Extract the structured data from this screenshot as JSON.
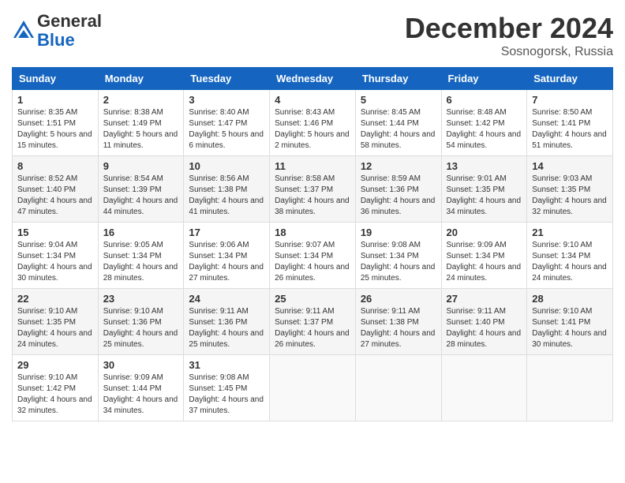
{
  "header": {
    "logo_general": "General",
    "logo_blue": "Blue",
    "month_title": "December 2024",
    "location": "Sosnogorsk, Russia"
  },
  "weekdays": [
    "Sunday",
    "Monday",
    "Tuesday",
    "Wednesday",
    "Thursday",
    "Friday",
    "Saturday"
  ],
  "weeks": [
    [
      {
        "day": "1",
        "sunrise": "8:35 AM",
        "sunset": "1:51 PM",
        "daylight": "5 hours and 15 minutes."
      },
      {
        "day": "2",
        "sunrise": "8:38 AM",
        "sunset": "1:49 PM",
        "daylight": "5 hours and 11 minutes."
      },
      {
        "day": "3",
        "sunrise": "8:40 AM",
        "sunset": "1:47 PM",
        "daylight": "5 hours and 6 minutes."
      },
      {
        "day": "4",
        "sunrise": "8:43 AM",
        "sunset": "1:46 PM",
        "daylight": "5 hours and 2 minutes."
      },
      {
        "day": "5",
        "sunrise": "8:45 AM",
        "sunset": "1:44 PM",
        "daylight": "4 hours and 58 minutes."
      },
      {
        "day": "6",
        "sunrise": "8:48 AM",
        "sunset": "1:42 PM",
        "daylight": "4 hours and 54 minutes."
      },
      {
        "day": "7",
        "sunrise": "8:50 AM",
        "sunset": "1:41 PM",
        "daylight": "4 hours and 51 minutes."
      }
    ],
    [
      {
        "day": "8",
        "sunrise": "8:52 AM",
        "sunset": "1:40 PM",
        "daylight": "4 hours and 47 minutes."
      },
      {
        "day": "9",
        "sunrise": "8:54 AM",
        "sunset": "1:39 PM",
        "daylight": "4 hours and 44 minutes."
      },
      {
        "day": "10",
        "sunrise": "8:56 AM",
        "sunset": "1:38 PM",
        "daylight": "4 hours and 41 minutes."
      },
      {
        "day": "11",
        "sunrise": "8:58 AM",
        "sunset": "1:37 PM",
        "daylight": "4 hours and 38 minutes."
      },
      {
        "day": "12",
        "sunrise": "8:59 AM",
        "sunset": "1:36 PM",
        "daylight": "4 hours and 36 minutes."
      },
      {
        "day": "13",
        "sunrise": "9:01 AM",
        "sunset": "1:35 PM",
        "daylight": "4 hours and 34 minutes."
      },
      {
        "day": "14",
        "sunrise": "9:03 AM",
        "sunset": "1:35 PM",
        "daylight": "4 hours and 32 minutes."
      }
    ],
    [
      {
        "day": "15",
        "sunrise": "9:04 AM",
        "sunset": "1:34 PM",
        "daylight": "4 hours and 30 minutes."
      },
      {
        "day": "16",
        "sunrise": "9:05 AM",
        "sunset": "1:34 PM",
        "daylight": "4 hours and 28 minutes."
      },
      {
        "day": "17",
        "sunrise": "9:06 AM",
        "sunset": "1:34 PM",
        "daylight": "4 hours and 27 minutes."
      },
      {
        "day": "18",
        "sunrise": "9:07 AM",
        "sunset": "1:34 PM",
        "daylight": "4 hours and 26 minutes."
      },
      {
        "day": "19",
        "sunrise": "9:08 AM",
        "sunset": "1:34 PM",
        "daylight": "4 hours and 25 minutes."
      },
      {
        "day": "20",
        "sunrise": "9:09 AM",
        "sunset": "1:34 PM",
        "daylight": "4 hours and 24 minutes."
      },
      {
        "day": "21",
        "sunrise": "9:10 AM",
        "sunset": "1:34 PM",
        "daylight": "4 hours and 24 minutes."
      }
    ],
    [
      {
        "day": "22",
        "sunrise": "9:10 AM",
        "sunset": "1:35 PM",
        "daylight": "4 hours and 24 minutes."
      },
      {
        "day": "23",
        "sunrise": "9:10 AM",
        "sunset": "1:36 PM",
        "daylight": "4 hours and 25 minutes."
      },
      {
        "day": "24",
        "sunrise": "9:11 AM",
        "sunset": "1:36 PM",
        "daylight": "4 hours and 25 minutes."
      },
      {
        "day": "25",
        "sunrise": "9:11 AM",
        "sunset": "1:37 PM",
        "daylight": "4 hours and 26 minutes."
      },
      {
        "day": "26",
        "sunrise": "9:11 AM",
        "sunset": "1:38 PM",
        "daylight": "4 hours and 27 minutes."
      },
      {
        "day": "27",
        "sunrise": "9:11 AM",
        "sunset": "1:40 PM",
        "daylight": "4 hours and 28 minutes."
      },
      {
        "day": "28",
        "sunrise": "9:10 AM",
        "sunset": "1:41 PM",
        "daylight": "4 hours and 30 minutes."
      }
    ],
    [
      {
        "day": "29",
        "sunrise": "9:10 AM",
        "sunset": "1:42 PM",
        "daylight": "4 hours and 32 minutes."
      },
      {
        "day": "30",
        "sunrise": "9:09 AM",
        "sunset": "1:44 PM",
        "daylight": "4 hours and 34 minutes."
      },
      {
        "day": "31",
        "sunrise": "9:08 AM",
        "sunset": "1:45 PM",
        "daylight": "4 hours and 37 minutes."
      },
      null,
      null,
      null,
      null
    ]
  ]
}
